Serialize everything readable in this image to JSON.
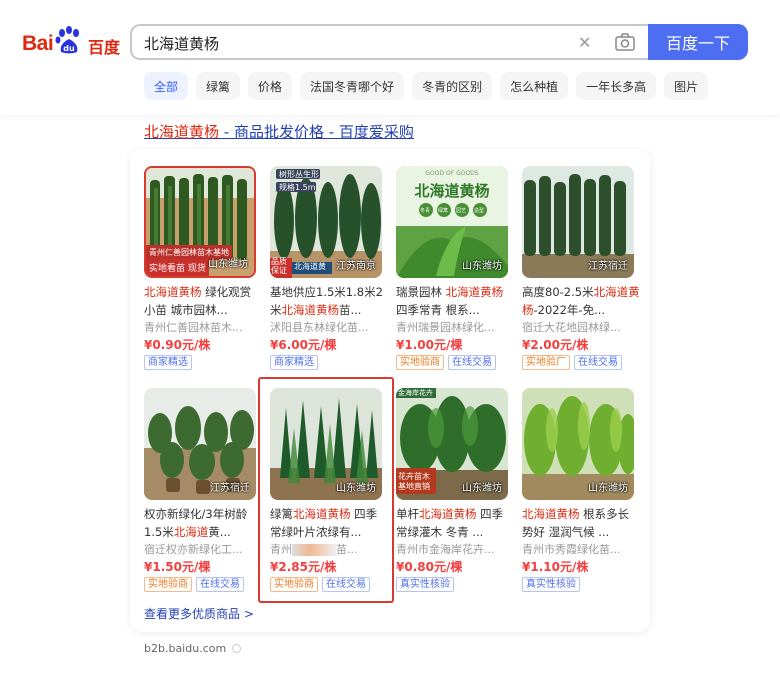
{
  "logo": {
    "bai": "Bai",
    "du": "百度"
  },
  "search": {
    "query": "北海道黄杨",
    "button_label": "百度一下"
  },
  "tags": [
    "全部",
    "绿篱",
    "价格",
    "法国冬青哪个好",
    "冬青的区别",
    "怎么种植",
    "一年长多高",
    "图片"
  ],
  "result": {
    "title_hl": "北海道黄杨",
    "title_rest": " - 商品批发价格 - 百度爱采购"
  },
  "products": [
    {
      "loc": "山东潍坊",
      "badge": "实地看苗 现货",
      "desc": [
        {
          "t": "北海道黄杨",
          "hl": true
        },
        {
          "t": " 绿化观赏小苗 城市园林...",
          "hl": false
        }
      ],
      "seller": "青州仁善园林苗木...",
      "price": "¥0.90元/株",
      "chips": [
        {
          "text": "商家精选",
          "style": "blue"
        }
      ]
    },
    {
      "loc": "江苏南京",
      "badge": "品质保证",
      "desc": [
        {
          "t": "基地供应1.5米1.8米2米",
          "hl": false
        },
        {
          "t": "北海道黄杨",
          "hl": true
        },
        {
          "t": "苗...",
          "hl": false
        }
      ],
      "seller": "沭阳县东林绿化苗...",
      "price": "¥6.00元/棵",
      "chips": [
        {
          "text": "商家精选",
          "style": "blue"
        }
      ]
    },
    {
      "loc": "山东潍坊",
      "badge": "",
      "desc": [
        {
          "t": "瑞景园林 ",
          "hl": false
        },
        {
          "t": "北海道黄杨",
          "hl": true
        },
        {
          "t": " 四季常青 根系...",
          "hl": false
        }
      ],
      "seller": "青州瑞景园林绿化...",
      "price": "¥1.00元/棵",
      "chips": [
        {
          "text": "实地验商",
          "style": "orange"
        },
        {
          "text": "在线交易",
          "style": "blue"
        }
      ]
    },
    {
      "loc": "江苏宿迁",
      "badge": "",
      "desc": [
        {
          "t": "高度80-2.5米",
          "hl": false
        },
        {
          "t": "北海道黄杨",
          "hl": true
        },
        {
          "t": "-2022年-免...",
          "hl": false
        }
      ],
      "seller": "宿迁大花地园林绿...",
      "price": "¥2.00元/株",
      "chips": [
        {
          "text": "实地验厂",
          "style": "orange"
        },
        {
          "text": "在线交易",
          "style": "blue"
        }
      ]
    },
    {
      "loc": "江苏宿迁",
      "badge": "",
      "desc": [
        {
          "t": "权亦新绿化/3年树龄1.5米",
          "hl": false
        },
        {
          "t": "北海道",
          "hl": true
        },
        {
          "t": "黄...",
          "hl": false
        }
      ],
      "seller": "宿迁权亦新绿化工...",
      "price": "¥1.50元/棵",
      "chips": [
        {
          "text": "实地验商",
          "style": "orange"
        },
        {
          "text": "在线交易",
          "style": "blue"
        }
      ]
    },
    {
      "loc": "山东潍坊",
      "badge": "",
      "desc": [
        {
          "t": "绿篱",
          "hl": false
        },
        {
          "t": "北海道黄杨",
          "hl": true
        },
        {
          "t": " 四季常绿叶片浓绿有...",
          "hl": false
        }
      ],
      "seller_pre": "青州",
      "seller_post": "苗...",
      "price": "¥2.85元/株",
      "chips": [
        {
          "text": "实地验商",
          "style": "orange"
        },
        {
          "text": "在线交易",
          "style": "blue"
        }
      ]
    },
    {
      "loc": "山东潍坊",
      "badge": "花卉苗木基地直销",
      "desc": [
        {
          "t": "单杆",
          "hl": false
        },
        {
          "t": "北海道黄杨",
          "hl": true
        },
        {
          "t": " 四季常绿灌木 冬青 ...",
          "hl": false
        }
      ],
      "seller": "青州市金海岸花卉...",
      "price": "¥0.80元/棵",
      "chips": [
        {
          "text": "真实性核验",
          "style": "blue"
        }
      ]
    },
    {
      "loc": "山东潍坊",
      "badge": "",
      "desc": [
        {
          "t": "北海道黄杨",
          "hl": true
        },
        {
          "t": " 根系多长势好 湿润气候 ...",
          "hl": false
        }
      ],
      "seller": "青州市秀霞绿化苗...",
      "price": "¥1.10元/株",
      "chips": [
        {
          "text": "真实性核验",
          "style": "blue"
        }
      ]
    }
  ],
  "thumb_texts": {
    "p1_top": "青州仁善园林苗木基地",
    "p2_top1": "树形丛生形",
    "p2_top2": "规格1.5m",
    "p2_tag": "北海道黄",
    "p3_title": "北海道黄杨",
    "p3_sub": "GOOD OF GOODS",
    "p3_chips": [
      "冬青",
      "绿篱",
      "园艺",
      "造型"
    ],
    "p7_top": "金海岸花卉"
  },
  "more_link": "查看更多优质商品 >",
  "source": "b2b.baidu.com",
  "colors": {
    "brand_red": "#de2910",
    "brand_blue": "#4e6ef2",
    "link": "#2440b3",
    "price": "#f53f3f",
    "highlight_box": "#d93a30"
  }
}
